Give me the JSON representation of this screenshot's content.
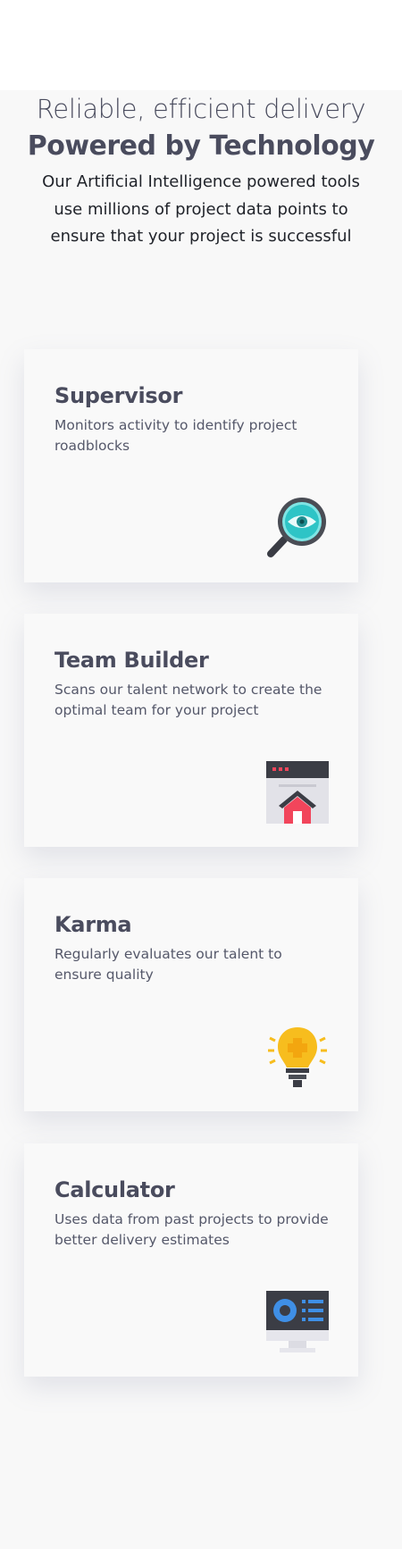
{
  "hero": {
    "kicker": "Reliable, efficient delivery",
    "title": "Powered by Technology",
    "subtitle": "Our Artificial Intelligence powered tools use millions of project data points to ensure that your project is successful"
  },
  "cards": [
    {
      "title": "Supervisor",
      "description": "Monitors activity to identify project roadblocks",
      "icon": "magnifier-eye-icon"
    },
    {
      "title": "Team Builder",
      "description": "Scans our talent network to create the optimal team for your project",
      "icon": "browser-house-icon"
    },
    {
      "title": "Karma",
      "description": "Regularly evaluates our talent to ensure quality",
      "icon": "lightbulb-puzzle-icon"
    },
    {
      "title": "Calculator",
      "description": "Uses data from past projects to provide better delivery estimates",
      "icon": "monitor-chart-icon"
    }
  ],
  "colors": {
    "heading": "#4a4c5e",
    "background": "#f8f8f8",
    "accent_teal": "#2ec4c6",
    "accent_red": "#f2455b",
    "accent_yellow": "#f7bd1e",
    "accent_blue": "#3f8fe6"
  }
}
